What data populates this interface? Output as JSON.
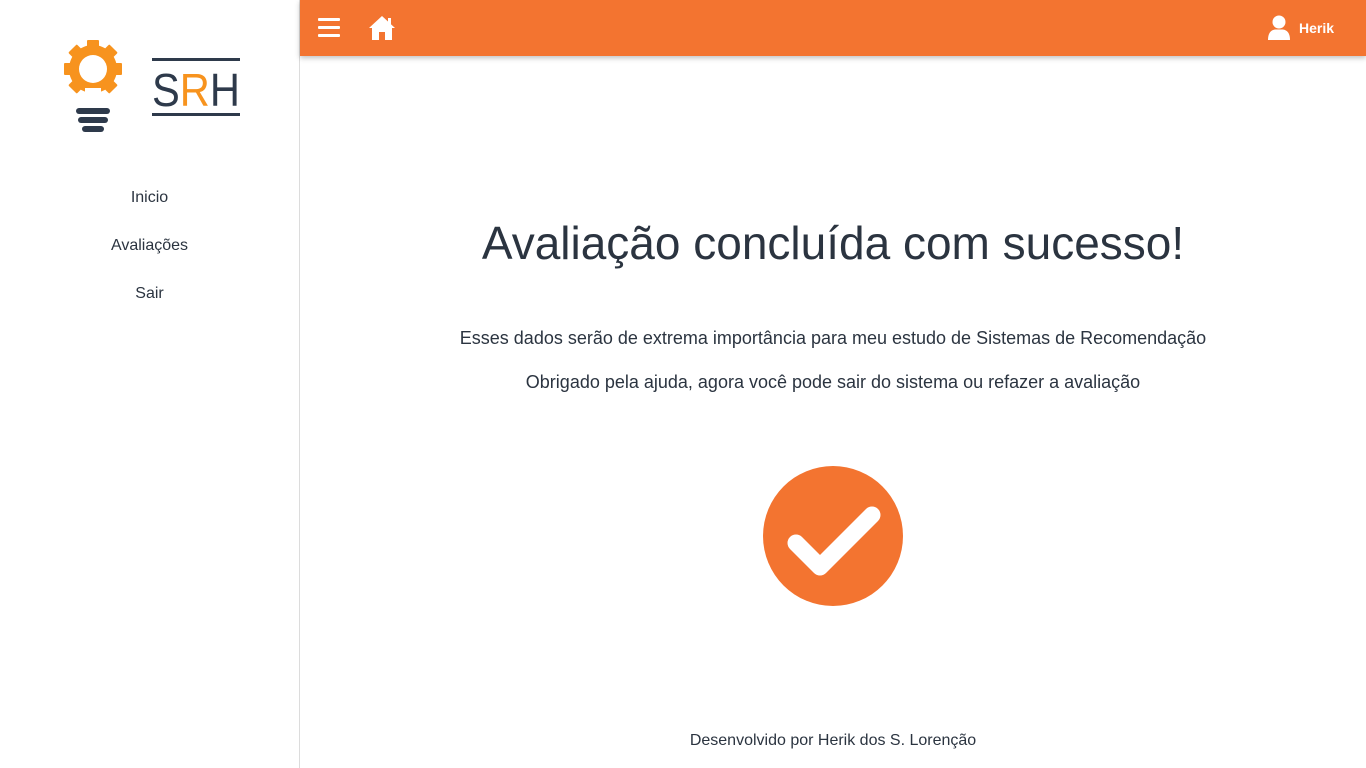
{
  "brand": {
    "logo_text": "SRH",
    "logo_icon": "lightbulb-gear-icon",
    "colors": {
      "orange": "#f7931e",
      "dark": "#2e3a4b"
    }
  },
  "sidebar": {
    "items": [
      {
        "label": "Inicio"
      },
      {
        "label": "Avaliações"
      },
      {
        "label": "Sair"
      }
    ]
  },
  "topbar": {
    "background": "#f37430",
    "menu_icon": "hamburger-menu-icon",
    "home_icon": "home-icon",
    "user_icon": "user-icon",
    "user_name": "Herik"
  },
  "main": {
    "title": "Avaliação concluída com sucesso!",
    "message_1": "Esses dados serão de extrema importância para meu estudo de Sistemas de Recomendação",
    "message_2": "Obrigado pela ajuda, agora você pode sair do sistema ou refazer a avaliação",
    "success_icon": "check-circle-icon",
    "success_color": "#f37430"
  },
  "footer": {
    "text": "Desenvolvido por Herik dos S. Lorenção"
  }
}
